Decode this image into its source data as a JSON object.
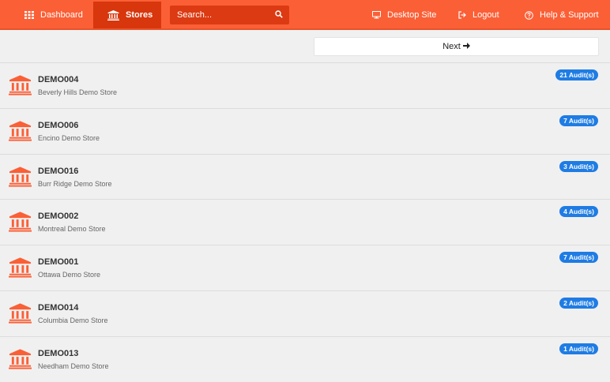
{
  "nav": {
    "dashboard_label": "Dashboard",
    "stores_label": "Stores",
    "search_placeholder": "Search...",
    "desktop_label": "Desktop Site",
    "logout_label": "Logout",
    "help_label": "Help & Support"
  },
  "pager": {
    "next_label": "Next"
  },
  "stores": [
    {
      "code": "DEMO004",
      "name": "Beverly Hills Demo Store",
      "audits": "21 Audit(s)"
    },
    {
      "code": "DEMO006",
      "name": "Encino Demo Store",
      "audits": "7 Audit(s)"
    },
    {
      "code": "DEMO016",
      "name": "Burr Ridge Demo Store",
      "audits": "3 Audit(s)"
    },
    {
      "code": "DEMO002",
      "name": "Montreal Demo Store",
      "audits": "4 Audit(s)"
    },
    {
      "code": "DEMO001",
      "name": "Ottawa Demo Store",
      "audits": "7 Audit(s)"
    },
    {
      "code": "DEMO014",
      "name": "Columbia Demo Store",
      "audits": "2 Audit(s)"
    },
    {
      "code": "DEMO013",
      "name": "Needham Demo Store",
      "audits": "1 Audit(s)"
    }
  ],
  "colors": {
    "navbar": "#fb5f36",
    "active_tab": "#d8360c",
    "search_bg": "#dc3a12",
    "store_icon": "#fb5f36",
    "badge": "#1e7ce4"
  },
  "icons": {
    "dashboard": "grid-icon",
    "stores": "bank-building-icon",
    "search": "search-icon",
    "desktop": "monitor-icon",
    "logout": "logout-icon",
    "help": "question-circle-icon",
    "next": "arrow-right-icon",
    "store": "bank-building-icon"
  }
}
